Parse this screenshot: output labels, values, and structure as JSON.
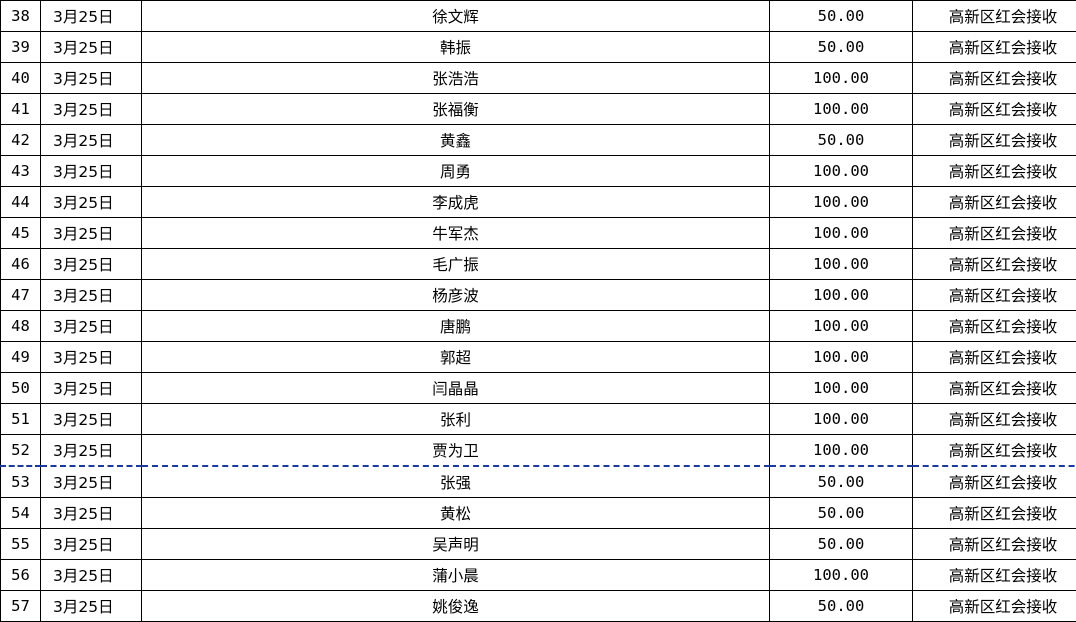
{
  "rows": [
    {
      "no": "38",
      "date": "3月25日",
      "name": "徐文辉",
      "amount": "50.00",
      "note": "高新区红会接收"
    },
    {
      "no": "39",
      "date": "3月25日",
      "name": "韩振",
      "amount": "50.00",
      "note": "高新区红会接收"
    },
    {
      "no": "40",
      "date": "3月25日",
      "name": "张浩浩",
      "amount": "100.00",
      "note": "高新区红会接收"
    },
    {
      "no": "41",
      "date": "3月25日",
      "name": "张福衡",
      "amount": "100.00",
      "note": "高新区红会接收"
    },
    {
      "no": "42",
      "date": "3月25日",
      "name": "黄鑫",
      "amount": "50.00",
      "note": "高新区红会接收"
    },
    {
      "no": "43",
      "date": "3月25日",
      "name": "周勇",
      "amount": "100.00",
      "note": "高新区红会接收"
    },
    {
      "no": "44",
      "date": "3月25日",
      "name": "李成虎",
      "amount": "100.00",
      "note": "高新区红会接收"
    },
    {
      "no": "45",
      "date": "3月25日",
      "name": "牛军杰",
      "amount": "100.00",
      "note": "高新区红会接收"
    },
    {
      "no": "46",
      "date": "3月25日",
      "name": "毛广振",
      "amount": "100.00",
      "note": "高新区红会接收"
    },
    {
      "no": "47",
      "date": "3月25日",
      "name": "杨彦波",
      "amount": "100.00",
      "note": "高新区红会接收"
    },
    {
      "no": "48",
      "date": "3月25日",
      "name": "唐鹏",
      "amount": "100.00",
      "note": "高新区红会接收"
    },
    {
      "no": "49",
      "date": "3月25日",
      "name": "郭超",
      "amount": "100.00",
      "note": "高新区红会接收"
    },
    {
      "no": "50",
      "date": "3月25日",
      "name": "闫晶晶",
      "amount": "100.00",
      "note": "高新区红会接收"
    },
    {
      "no": "51",
      "date": "3月25日",
      "name": "张利",
      "amount": "100.00",
      "note": "高新区红会接收"
    },
    {
      "no": "52",
      "date": "3月25日",
      "name": "贾为卫",
      "amount": "100.00",
      "note": "高新区红会接收"
    },
    {
      "no": "53",
      "date": "3月25日",
      "name": "张强",
      "amount": "50.00",
      "note": "高新区红会接收"
    },
    {
      "no": "54",
      "date": "3月25日",
      "name": "黄松",
      "amount": "50.00",
      "note": "高新区红会接收"
    },
    {
      "no": "55",
      "date": "3月25日",
      "name": "吴声明",
      "amount": "50.00",
      "note": "高新区红会接收"
    },
    {
      "no": "56",
      "date": "3月25日",
      "name": "蒲小晨",
      "amount": "100.00",
      "note": "高新区红会接收"
    },
    {
      "no": "57",
      "date": "3月25日",
      "name": "姚俊逸",
      "amount": "50.00",
      "note": "高新区红会接收"
    }
  ],
  "page_break_after_row": "52"
}
